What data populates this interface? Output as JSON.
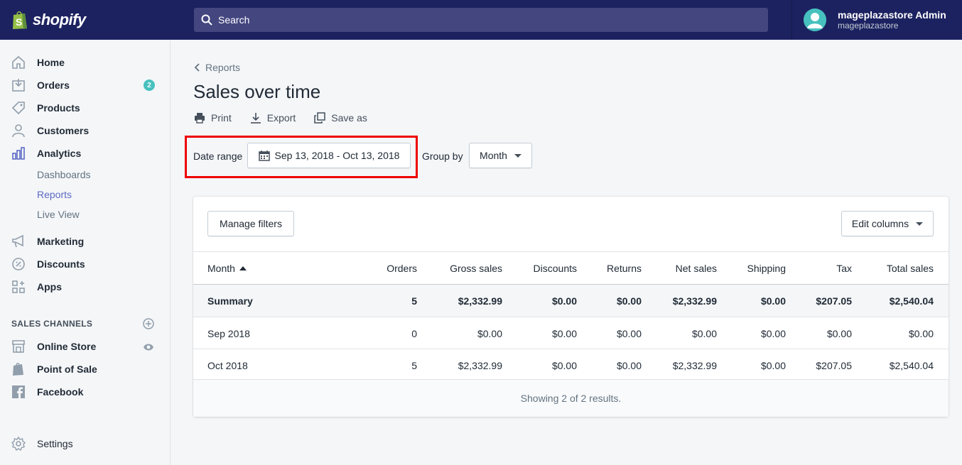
{
  "app": {
    "brand": "shopify"
  },
  "topbar": {
    "search_placeholder": "Search"
  },
  "user": {
    "name": "mageplazastore Admin",
    "store": "mageplazastore"
  },
  "sidebar": {
    "items": [
      {
        "label": "Home"
      },
      {
        "label": "Orders",
        "badge": "2"
      },
      {
        "label": "Products"
      },
      {
        "label": "Customers"
      },
      {
        "label": "Analytics"
      },
      {
        "label": "Marketing"
      },
      {
        "label": "Discounts"
      },
      {
        "label": "Apps"
      }
    ],
    "analytics_sub": [
      {
        "label": "Dashboards"
      },
      {
        "label": "Reports"
      },
      {
        "label": "Live View"
      }
    ],
    "sales_channels_title": "SALES CHANNELS",
    "channels": [
      {
        "label": "Online Store"
      },
      {
        "label": "Point of Sale"
      },
      {
        "label": "Facebook"
      }
    ],
    "settings": "Settings"
  },
  "page": {
    "breadcrumb": "Reports",
    "title": "Sales over time",
    "actions": {
      "print": "Print",
      "export": "Export",
      "save_as": "Save as"
    },
    "date_range_label": "Date range",
    "date_range_value": "Sep 13, 2018 - Oct 13, 2018",
    "group_by_label": "Group by",
    "group_by_value": "Month"
  },
  "report": {
    "manage_filters": "Manage filters",
    "edit_columns": "Edit columns",
    "columns": [
      "Month",
      "Orders",
      "Gross sales",
      "Discounts",
      "Returns",
      "Net sales",
      "Shipping",
      "Tax",
      "Total sales"
    ],
    "summary": [
      "Summary",
      "5",
      "$2,332.99",
      "$0.00",
      "$0.00",
      "$2,332.99",
      "$0.00",
      "$207.05",
      "$2,540.04"
    ],
    "rows": [
      [
        "Sep 2018",
        "0",
        "$0.00",
        "$0.00",
        "$0.00",
        "$0.00",
        "$0.00",
        "$0.00",
        "$0.00"
      ],
      [
        "Oct 2018",
        "5",
        "$2,332.99",
        "$0.00",
        "$0.00",
        "$2,332.99",
        "$0.00",
        "$207.05",
        "$2,540.04"
      ]
    ],
    "footer": "Showing 2 of 2 results."
  },
  "colors": {
    "topbar": "#1c2260",
    "accent": "#5c6ac4",
    "badge": "#47c1bf",
    "highlight": "#e00000"
  }
}
